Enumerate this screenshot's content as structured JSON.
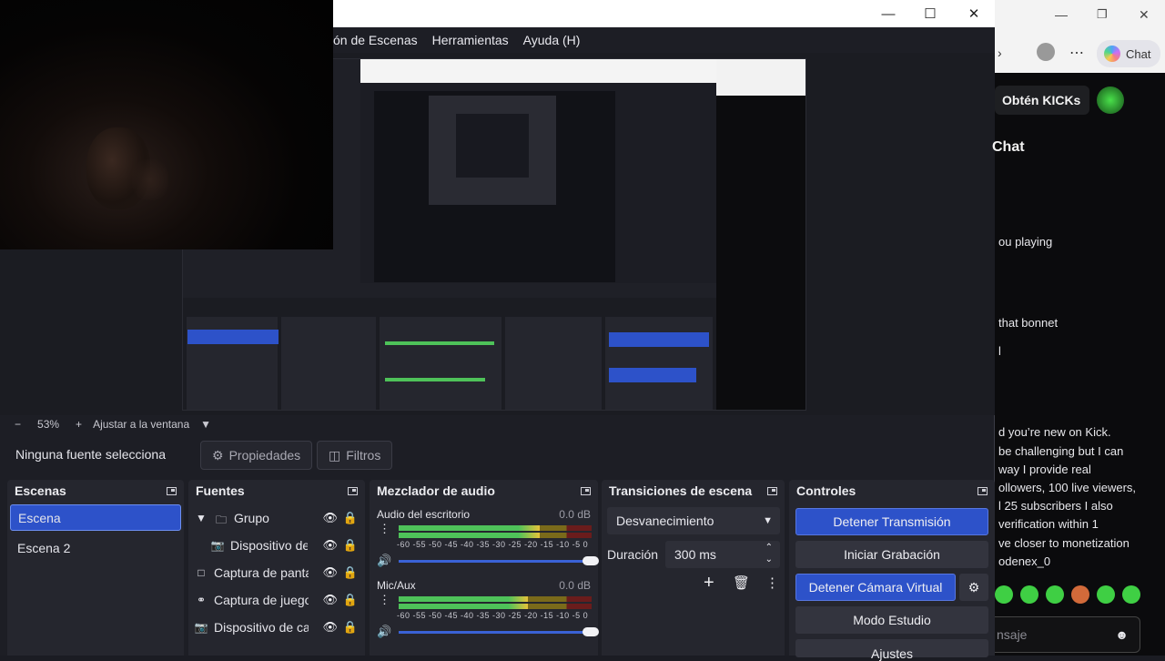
{
  "window": {
    "minimize_icon": "minimize-icon",
    "maximize_icon": "maximize-icon",
    "close_icon": "close-icon"
  },
  "menu": {
    "items": [
      "ón de Escenas",
      "Herramientas",
      "Ayuda (H)"
    ]
  },
  "zoom": {
    "minus": "−",
    "value": "53%",
    "plus": "+",
    "fit": "Ajustar a la ventana"
  },
  "source_bar": {
    "selection": "Ninguna fuente selecciona",
    "properties": "Propiedades",
    "filters": "Filtros"
  },
  "scenes": {
    "title": "Escenas",
    "items": [
      "Escena",
      "Escena 2"
    ]
  },
  "sources": {
    "title": "Fuentes",
    "items": [
      "Grupo",
      "Dispositivo de",
      "Captura de panta",
      "Captura de juego",
      "Dispositivo de ca"
    ]
  },
  "mixer": {
    "title": "Mezclador de audio",
    "channels": [
      {
        "name": "Audio del escritorio",
        "db": "0.0 dB",
        "level": 0.73
      },
      {
        "name": "Mic/Aux",
        "db": "0.0 dB",
        "level": 0.67
      }
    ],
    "ticks": "-60 -55 -50 -45 -40 -35 -30 -25 -20 -15 -10 -5  0"
  },
  "transitions": {
    "title": "Transiciones de escena",
    "type": "Desvanecimiento",
    "duration_label": "Duración",
    "duration_value": "300 ms"
  },
  "controls": {
    "title": "Controles",
    "stop_stream": "Detener Transmisión",
    "start_recording": "Iniciar Grabación",
    "stop_virtual_cam": "Detener Cámara Virtual",
    "studio_mode": "Modo Estudio",
    "settings": "Ajustes"
  },
  "browser": {
    "chat_button": "Chat",
    "kicks_button": "Obtén KICKs",
    "chat_title": "Chat",
    "lines": [
      "ou playing",
      "that bonnet",
      "l",
      "d you’re new on Kick.",
      "be challenging but I can",
      "way I provide real",
      "ollowers, 100 live viewers,",
      "l 25 subscribers I also",
      "verification within 1",
      "ve closer to monetization",
      "odenex_0"
    ],
    "message_placeholder": "nsaje"
  },
  "colors": {
    "accent": "#2d52c9",
    "dock_bg": "#25262e",
    "app_bg": "#1d1e25"
  }
}
